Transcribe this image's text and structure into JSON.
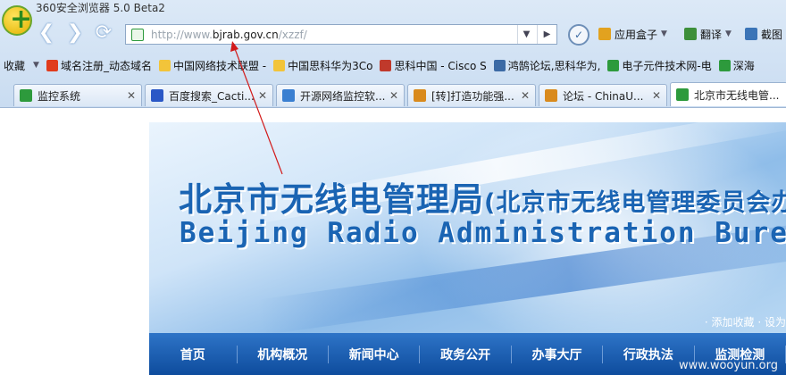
{
  "window": {
    "title": "360安全浏览器 5.0 Beta2"
  },
  "toolbar": {
    "url_prefix": "http://www.",
    "url_host": "bjrab.gov.cn",
    "url_path": "/xzzf/",
    "apps_label": "应用盒子",
    "translate_label": "翻译",
    "screenshot_label": "截图"
  },
  "bookmarks": [
    {
      "label": "收藏",
      "icon": "favorites-icon",
      "color": "#c9dcf1"
    },
    {
      "label": "域名注册_动态域名",
      "icon": "ring-icon",
      "color": "#e03b1c"
    },
    {
      "label": "中国网络技术联盟 -",
      "icon": "folder-icon",
      "color": "#f2c43a"
    },
    {
      "label": "中国思科华为3Co",
      "icon": "folder-icon",
      "color": "#f2c43a"
    },
    {
      "label": "思科中国 - Cisco S",
      "icon": "cisco-icon",
      "color": "#c0392b"
    },
    {
      "label": "鸿鹄论坛,思科华为,",
      "icon": "bird-icon",
      "color": "#3b6aa5"
    },
    {
      "label": "电子元件技术网-电",
      "icon": "page-icon",
      "color": "#2d9a3c"
    },
    {
      "label": "深海",
      "icon": "page-icon",
      "color": "#2d9a3c"
    }
  ],
  "tabs": [
    {
      "label": "监控系统",
      "icon": "page-icon",
      "color": "#2d9a3c"
    },
    {
      "label": "百度搜索_Cacti...",
      "icon": "baidu-paw-icon",
      "color": "#2a57c6"
    },
    {
      "label": "开源网络监控软...",
      "icon": "site-icon",
      "color": "#3a7fd1"
    },
    {
      "label": "[转]打造功能强...",
      "icon": "chinaunix-icon",
      "color": "#d98a1d"
    },
    {
      "label": "论坛 - ChinaU...",
      "icon": "chinaunix-icon",
      "color": "#d98a1d"
    },
    {
      "label": "北京市无线电管...",
      "icon": "page-icon",
      "color": "#2d9a3c"
    }
  ],
  "banner": {
    "title_main": "北京市无线电管理局",
    "title_sub": "(北京市无线电管理委员会办公室)",
    "title_en": "Beijing Radio Administration Bureau",
    "links": "· 添加收藏   · 设为"
  },
  "menu": [
    "首页",
    "机构概况",
    "新闻中心",
    "政务公开",
    "办事大厅",
    "行政执法",
    "监测检测"
  ],
  "watermark": "www.wooyun.org"
}
